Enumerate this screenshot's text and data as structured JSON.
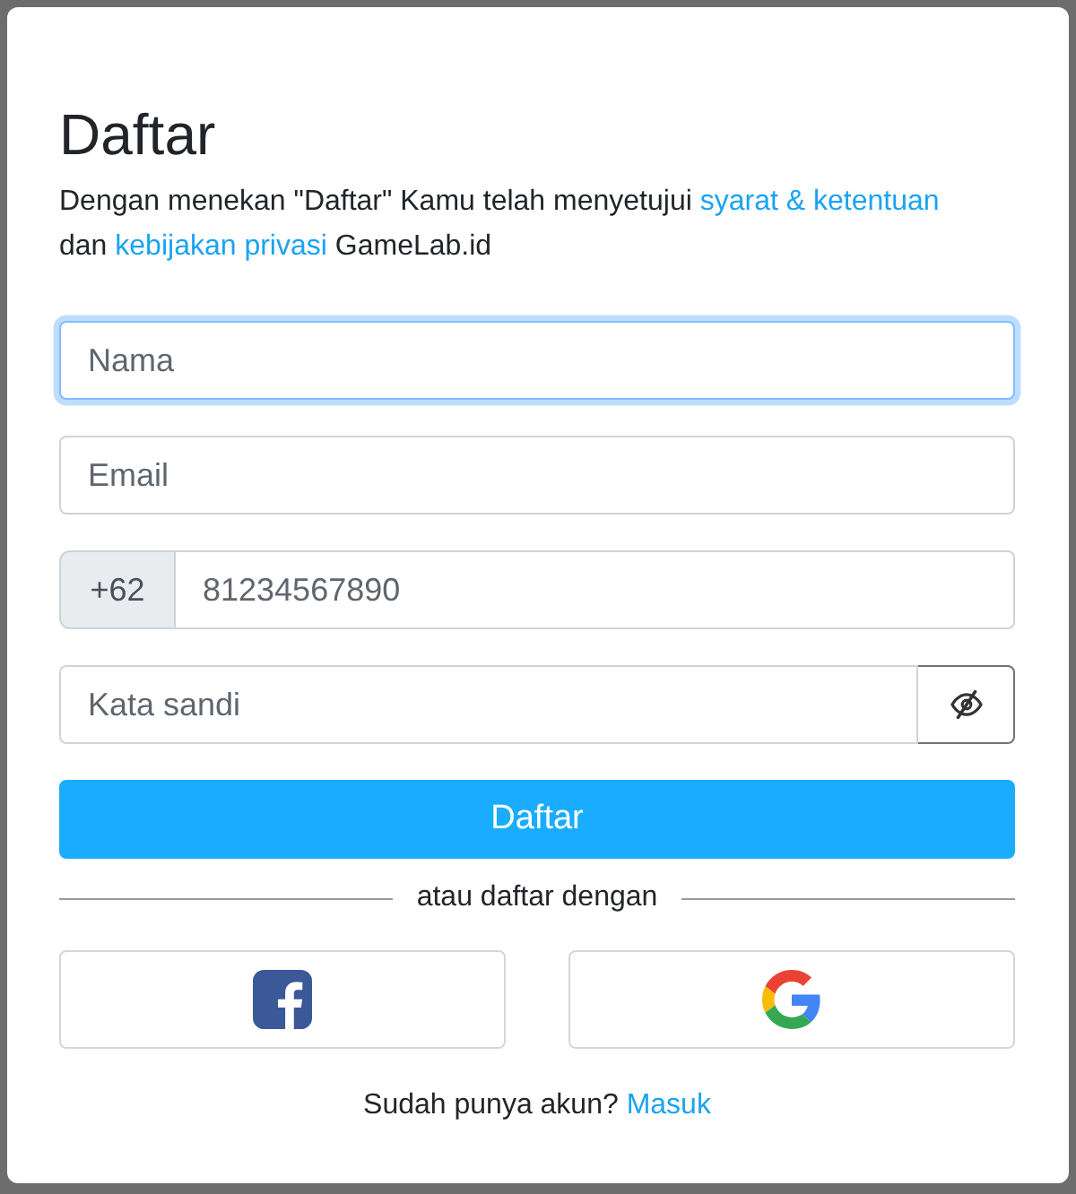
{
  "dialog": {
    "title": "Daftar",
    "intro": [
      {
        "kind": "text",
        "text": "Dengan menekan \"Daftar\" Kamu telah menyetujui"
      },
      {
        "kind": "link",
        "text": "syarat & ketentuan"
      },
      {
        "kind": "text",
        "text": "dan"
      },
      {
        "kind": "link",
        "text": "kebijakan privasi"
      },
      {
        "kind": "text",
        "text": "GameLab.id"
      }
    ],
    "fields": [
      {
        "kind": "text",
        "placeholder": "Nama",
        "focused": true
      },
      {
        "kind": "text",
        "placeholder": "Email",
        "focused": false
      },
      {
        "kind": "phone",
        "prefix": "+62",
        "placeholder": "81234567890",
        "focused": false
      },
      {
        "kind": "password",
        "placeholder": "Kata sandi",
        "focused": false,
        "revealed": false
      }
    ],
    "submit_button": "Daftar",
    "divider_text": "atau daftar dengan",
    "social_buttons": [
      {
        "kind": "facebook"
      },
      {
        "kind": "google"
      }
    ],
    "footer": {
      "text": "Sudah punya akun?",
      "link": "Masuk"
    }
  }
}
